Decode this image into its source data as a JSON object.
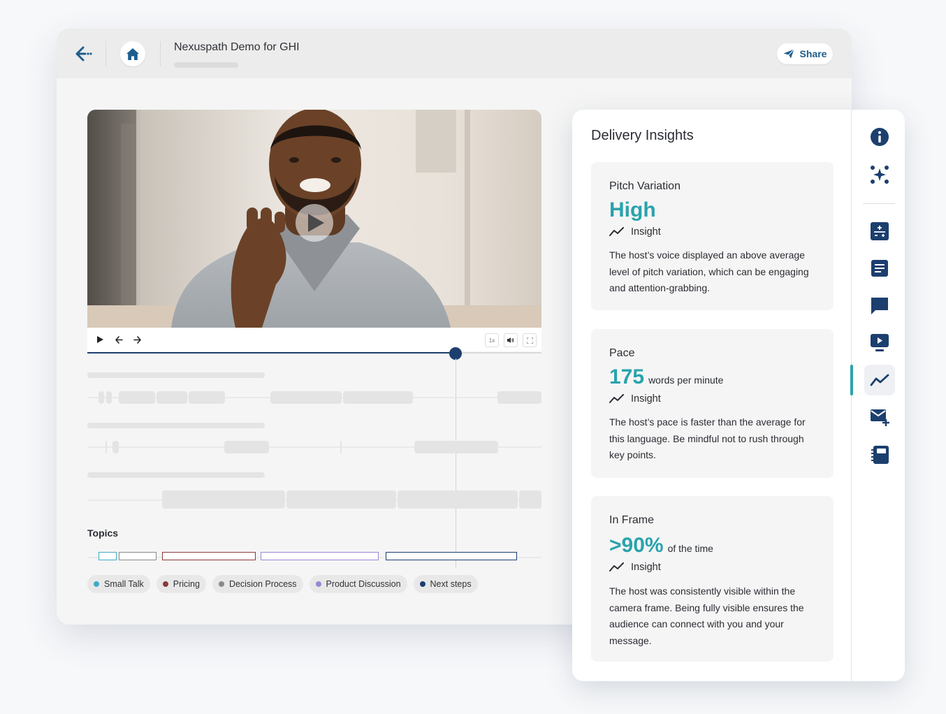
{
  "header": {
    "title": "Nexuspath Demo for GHI",
    "share_label": "Share"
  },
  "video": {
    "speed_label": "1x",
    "progress": 0.81
  },
  "topics": {
    "label": "Topics",
    "items": [
      {
        "label": "Small Talk",
        "color": "#3fa9c9"
      },
      {
        "label": "Pricing",
        "color": "#8b3a3a"
      },
      {
        "label": "Decision Process",
        "color": "#8a8a8a"
      },
      {
        "label": "Product Discussion",
        "color": "#9b86d6"
      },
      {
        "label": "Next steps",
        "color": "#1c3f6e"
      }
    ]
  },
  "insights_panel": {
    "title": "Delivery Insights",
    "cards": [
      {
        "title": "Pitch Variation",
        "value": "High",
        "unit": "",
        "insight_label": "Insight",
        "description": "The host’s voice displayed an above average level of pitch variation, which can be engaging and attention-grabbing."
      },
      {
        "title": "Pace",
        "value": "175",
        "unit": "words per minute",
        "insight_label": "Insight",
        "description": "The host’s pace is faster than the average for this language. Be mindful not to rush through key points."
      },
      {
        "title": "In Frame",
        "value": ">90%",
        "unit": "of the time",
        "insight_label": "Insight",
        "description": "The host was consistently visible within the camera frame. Being fully visible ensures the audience can connect with you and your message."
      }
    ]
  },
  "rail": {
    "icons": [
      "info-icon",
      "sparkle-icon",
      "calculator-icon",
      "document-icon",
      "chat-icon",
      "presentation-icon",
      "insights-icon",
      "email-add-icon",
      "notebook-icon"
    ],
    "active": "insights-icon"
  },
  "colors": {
    "accent": "#2aa3ad",
    "navy": "#1c3f6e",
    "share_text": "#1e5e8c"
  }
}
